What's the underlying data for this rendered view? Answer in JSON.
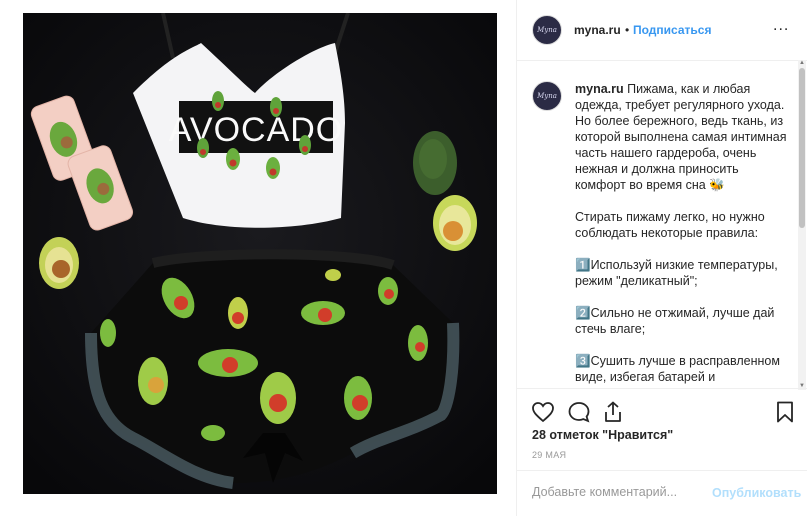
{
  "post": {
    "username": "myna.ru",
    "dot": "•",
    "follow_label": "Подписаться",
    "more_label": "...",
    "avatar_text": "Myna",
    "caption_text": "Пижама, как и любая одежда, требует регулярного ухода. Но более бережного, ведь ткань, из которой выполнена самая интимная часть нашего гардероба, очень нежная и должна приносить комфорт во время сна 🐝\n\nСтирать пижаму легко, но нужно соблюдать некоторые правила:\n\n1️⃣Используй низкие температуры, режим \"деликатный\";\n\n2️⃣Сильно не отжимай, лучше дай стечь влаге;\n\n3️⃣Сушить лучше в расправленном виде, избегая батарей и обогревателей;",
    "likes": "28 отметок \"Нравится\"",
    "date": "29 МАЯ",
    "comment_placeholder": "Добавьте комментарий...",
    "publish_label": "Опубликовать"
  },
  "photo": {
    "shirt_print": "AVOCADO"
  },
  "icons": {
    "like": "heart-icon",
    "comment": "comment-icon",
    "share": "share-icon",
    "save": "bookmark-icon"
  },
  "colors": {
    "link_blue": "#3897f0",
    "publish_disabled": "#b2dffc",
    "background": "#ffffff"
  }
}
